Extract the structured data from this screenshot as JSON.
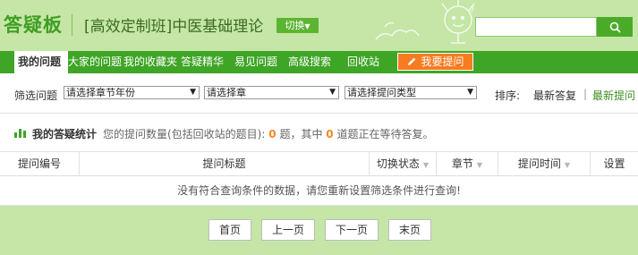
{
  "header": {
    "logo": "答疑板",
    "course_title": "[高效定制班]中医基础理论",
    "switch_label": "切换",
    "search": {
      "value": "",
      "placeholder": ""
    }
  },
  "nav": {
    "items": [
      {
        "label": "我的问题",
        "active": true
      },
      {
        "label": "大家的问题",
        "active": false
      },
      {
        "label": "我的收藏夹",
        "active": false
      },
      {
        "label": "答疑精华",
        "active": false
      },
      {
        "label": "易见问题",
        "active": false
      },
      {
        "label": "高级搜索",
        "active": false
      },
      {
        "label": "回收站",
        "active": false
      }
    ],
    "ask_label": "我要提问"
  },
  "filter": {
    "label": "筛选问题",
    "selects": [
      {
        "value": "请选择章节年份"
      },
      {
        "value": "请选择章"
      },
      {
        "value": "请选择提问类型"
      }
    ],
    "sort_label": "排序:",
    "sort_options": [
      {
        "label": "最新答复",
        "selected": false
      },
      {
        "label": "最新提问",
        "selected": true
      }
    ],
    "sort_separator": "|"
  },
  "stats": {
    "title": "我的答疑统计",
    "text_before": "您的提问数量(包括回收站的题目):",
    "total": "0",
    "text_middle": "题，其中",
    "waiting": "0",
    "text_after": "道题正在等待答复。"
  },
  "table": {
    "columns": [
      "提问编号",
      "提问标题",
      "切换状态",
      "章节",
      "提问时间",
      "设置"
    ],
    "empty_message": "没有符合查询条件的数据，请您重新设置筛选条件进行查询!"
  },
  "pager": {
    "first": "首页",
    "prev": "上一页",
    "next": "下一页",
    "last": "末页"
  },
  "colors": {
    "brand_green": "#3fa526",
    "header_bg": "#c5e6a6",
    "accent_orange": "#f77b21",
    "count_orange": "#f08a24"
  }
}
